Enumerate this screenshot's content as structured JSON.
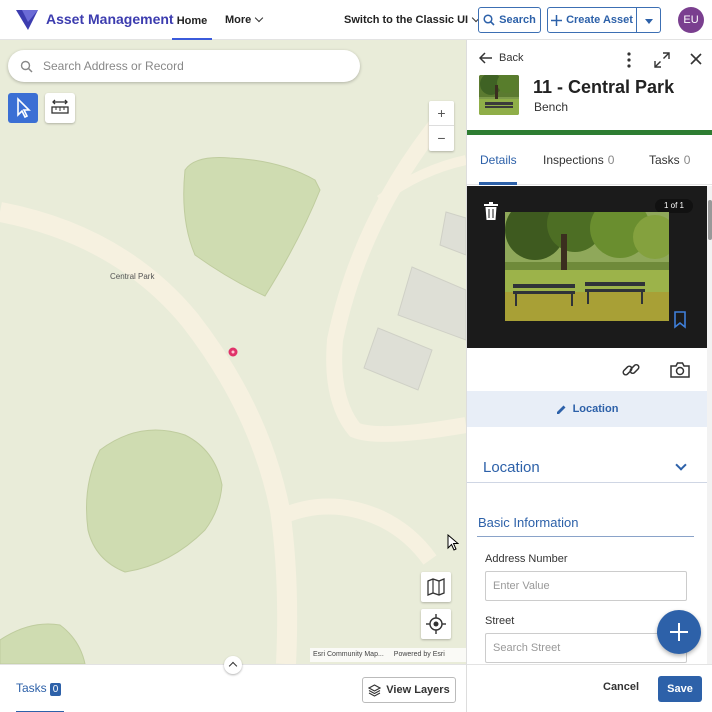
{
  "header": {
    "app_title": "Asset Management",
    "nav_home": "Home",
    "nav_more": "More",
    "switch_classic": "Switch to the Classic UI",
    "search_label": "Search",
    "create_label": "Create Asset",
    "avatar_initials": "EU",
    "brand_color": "#3c3caf",
    "accent_color": "#2d61a9"
  },
  "map": {
    "search_placeholder": "Search Address or Record",
    "place_label": "Central Park",
    "attribution": "Esri Community Map...",
    "powered_by": "Powered by Esri",
    "zoom_in": "+",
    "zoom_out": "−"
  },
  "bottom": {
    "tasks_label": "Tasks",
    "tasks_count": "0",
    "view_layers": "View Layers"
  },
  "panel": {
    "back_label": "Back",
    "record_title": "11 - Central Park",
    "record_subtitle": "Bench",
    "status_color": "#2e7d32",
    "tabs": [
      {
        "label": "Details",
        "count": ""
      },
      {
        "label": "Inspections",
        "count": "0"
      },
      {
        "label": "Tasks",
        "count": "0"
      }
    ],
    "photo_count": "1 of 1",
    "location_button": "Location",
    "location_section": "Location",
    "basic_info": "Basic Information",
    "fields": [
      {
        "label": "Address Number",
        "placeholder": "Enter Value"
      },
      {
        "label": "Street",
        "placeholder": "Search Street"
      }
    ],
    "cancel_label": "Cancel",
    "save_label": "Save"
  }
}
